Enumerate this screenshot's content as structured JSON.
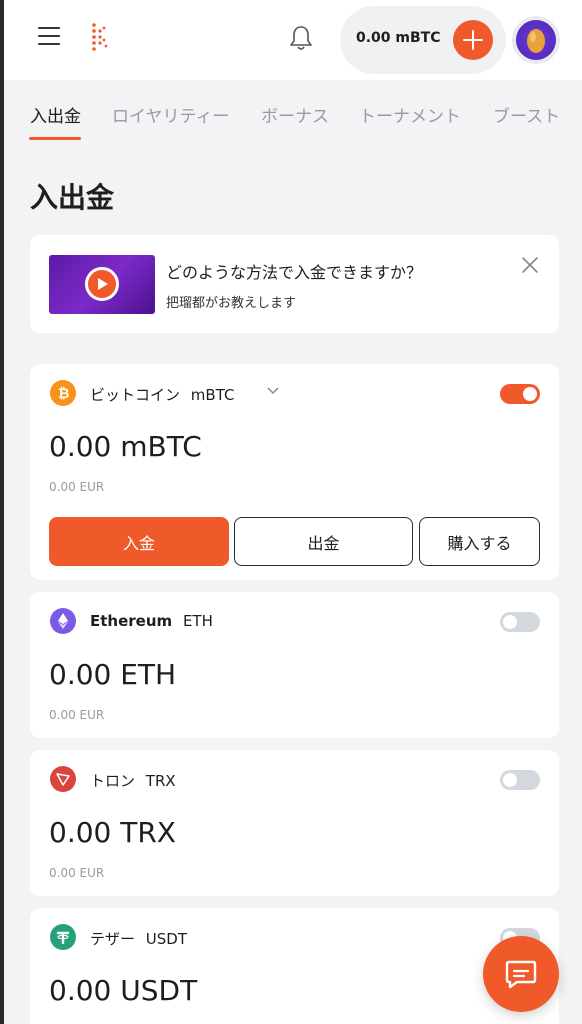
{
  "header": {
    "balance": "0.00 mBTC"
  },
  "tabs": [
    {
      "label": "入出金"
    },
    {
      "label": "ロイヤリティー"
    },
    {
      "label": "ボーナス"
    },
    {
      "label": "トーナメント"
    },
    {
      "label": "ブースト"
    }
  ],
  "page": {
    "title": "入出金"
  },
  "promo": {
    "title": "どのような方法で入金できますか？",
    "subtitle": "把瑠都がお教えします"
  },
  "wallets": [
    {
      "name": "ビットコイン",
      "ticker": "mBTC",
      "amount": "0.00 mBTC",
      "fiat": "0.00 EUR",
      "enabled": true,
      "icon": "bitcoin-icon",
      "color": "#f7931a",
      "actions": {
        "deposit": "入金",
        "withdraw": "出金",
        "buy": "購入する"
      }
    },
    {
      "name": "Ethereum",
      "ticker": "ETH",
      "amount": "0.00 ETH",
      "fiat": "0.00 EUR",
      "enabled": false,
      "icon": "ethereum-icon",
      "color": "#7b5be6"
    },
    {
      "name": "トロン",
      "ticker": "TRX",
      "amount": "0.00 TRX",
      "fiat": "0.00 EUR",
      "enabled": false,
      "icon": "tron-icon",
      "color": "#d9453c"
    },
    {
      "name": "テザー",
      "ticker": "USDT",
      "amount": "0.00 USDT",
      "enabled": false,
      "icon": "tether-icon",
      "color": "#26a17b"
    }
  ],
  "colors": {
    "accent": "#f05a2b",
    "background": "#f3f3f5",
    "toggle_off": "#d3d8de"
  }
}
